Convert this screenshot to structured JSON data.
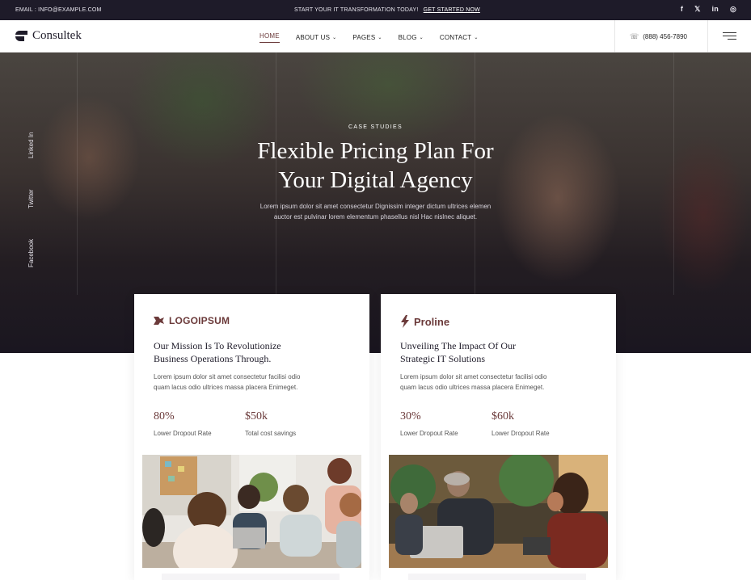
{
  "topbar": {
    "email": "EMAIL : INFO@EXAMPLE.COM",
    "promo_text": "START YOUR IT TRANSFORMATION TODAY!",
    "promo_link": "GET STARTED NOW",
    "socials": [
      "f",
      "𝕏",
      "in",
      "◎"
    ]
  },
  "navbar": {
    "logo": "Consultek",
    "menu": [
      {
        "label": "HOME"
      },
      {
        "label": "ABOUT US"
      },
      {
        "label": "PAGES"
      },
      {
        "label": "BLOG"
      },
      {
        "label": "CONTACT"
      }
    ],
    "phone": "(888) 456-7890"
  },
  "hero": {
    "eyebrow": "CASE STUDIES",
    "title_line1": "Flexible Pricing Plan For",
    "title_line2": "Your Digital Agency",
    "lead_line1": "Lorem ipsum dolor sit amet consectetur Dignissim integer dictum ultrices elemen",
    "lead_line2": "auctor est pulvinar lorem elementum phasellus nisl Hac nislnec aliquet.",
    "side_socials": [
      "Linked In",
      "Twitter",
      "Facebook"
    ]
  },
  "cards": [
    {
      "brand": "LOGOIPSUM",
      "title_line1": "Our Mission Is To Revolutionize",
      "title_line2": "Business Operations Through.",
      "desc_line1": "Lorem ipsum dolor sit amet consectetur facilisi odio",
      "desc_line2": "quam lacus odio ultrices massa placera Enimeget.",
      "stats": [
        {
          "value": "80%",
          "label": "Lower Dropout Rate"
        },
        {
          "value": "$50k",
          "label": "Total cost savings"
        }
      ]
    },
    {
      "brand": "Proline",
      "title_line1": "Unveiling The Impact Of Our",
      "title_line2": "Strategic IT Solutions",
      "desc_line1": "Lorem ipsum dolor sit amet consectetur facilisi odio",
      "desc_line2": "quam lacus odio ultrices massa placera Enimeget.",
      "stats": [
        {
          "value": "30%",
          "label": "Lower Dropout Rate"
        },
        {
          "value": "$60k",
          "label": "Lower Dropout Rate"
        }
      ]
    }
  ],
  "colors": {
    "dark": "#1e1b29",
    "accent": "#6b3a3a"
  }
}
